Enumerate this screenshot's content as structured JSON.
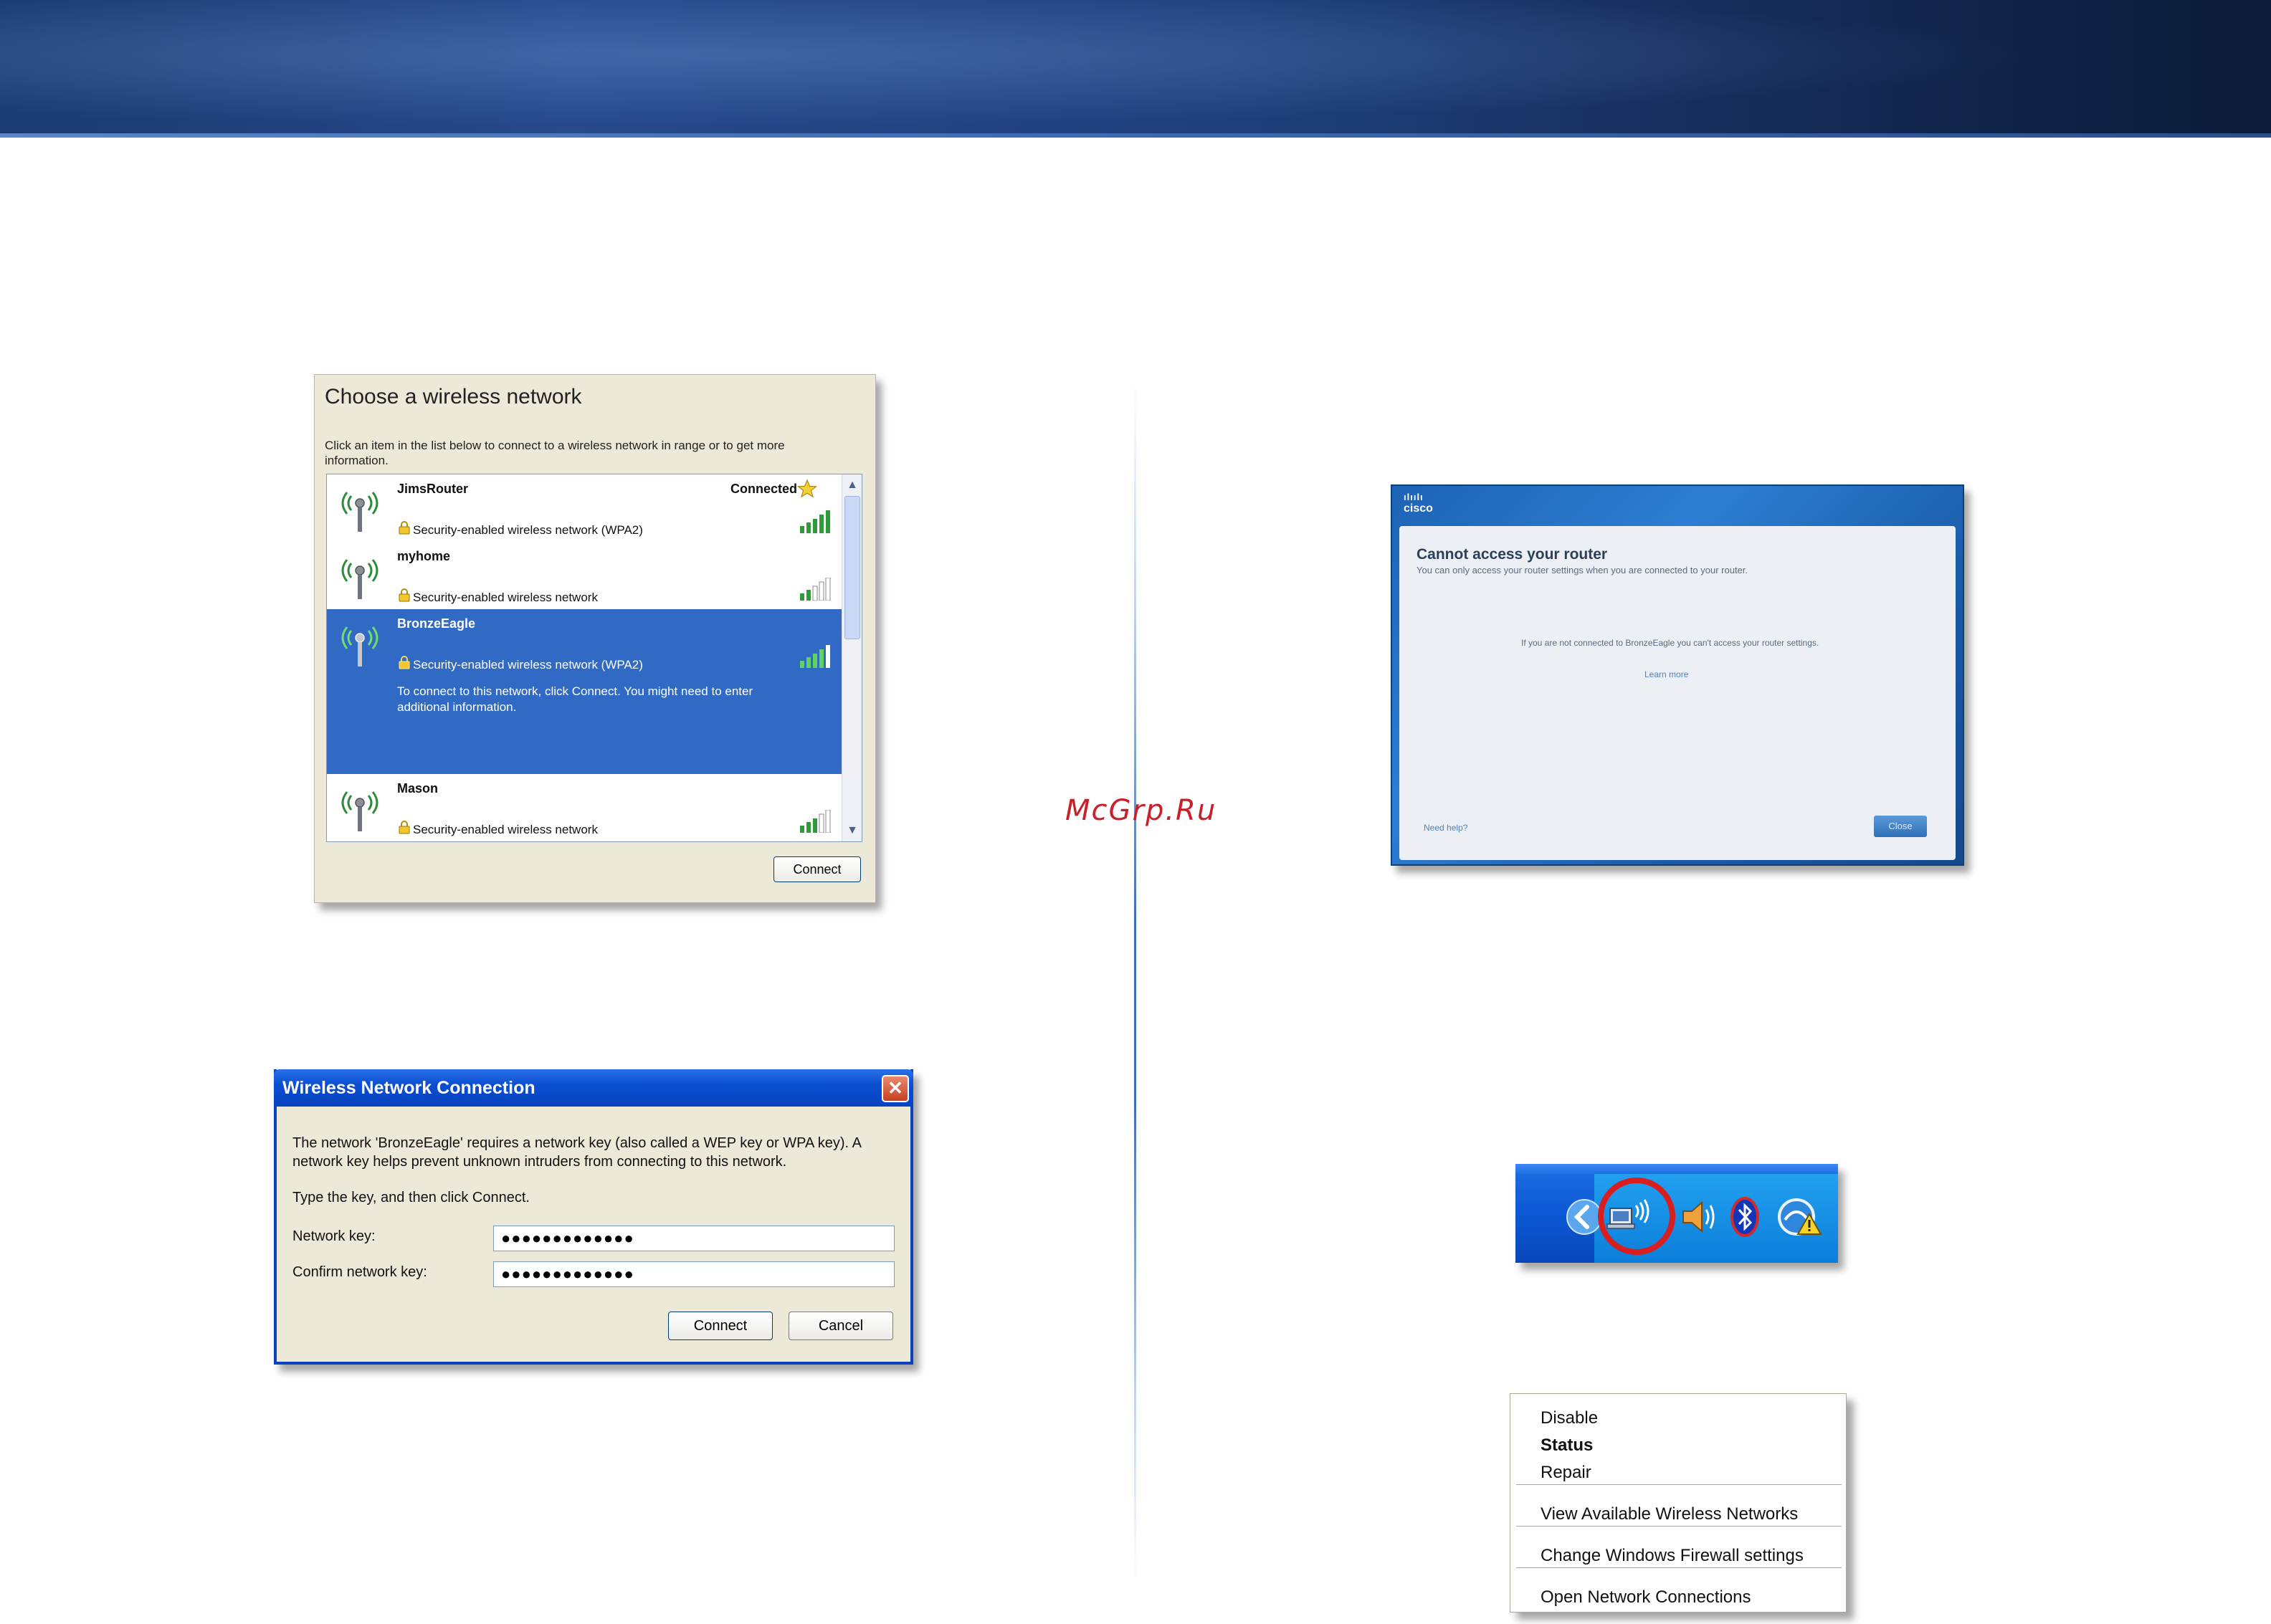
{
  "watermark": "McGrp.Ru",
  "choose_dialog": {
    "title": "Choose a wireless network",
    "description": "Click an item in the list below to connect to a wireless network in range or to get more information.",
    "networks": [
      {
        "name": "JimsRouter",
        "status": "Connected",
        "security": "Security-enabled wireless network (WPA2)"
      },
      {
        "name": "myhome",
        "status": "",
        "security": "Security-enabled wireless network"
      },
      {
        "name": "BronzeEagle",
        "status": "",
        "security": "Security-enabled wireless network (WPA2)",
        "hint": "To connect to this network, click Connect. You might need to enter additional information."
      },
      {
        "name": "Mason",
        "status": "",
        "security": "Security-enabled wireless network"
      }
    ],
    "connect_label": "Connect",
    "selected_color": "#316ac5"
  },
  "key_dialog": {
    "title": "Wireless Network Connection",
    "close_glyph": "✕",
    "message": "The network 'BronzeEagle' requires a network key (also called a WEP key or WPA key). A network key helps prevent unknown intruders from connecting to this network.",
    "instruction": "Type the key, and then click Connect.",
    "network_key_label": "Network key:",
    "network_key_value": "●●●●●●●●●●●●●",
    "confirm_key_label": "Confirm network key:",
    "confirm_key_value": "●●●●●●●●●●●●●",
    "connect_label": "Connect",
    "cancel_label": "Cancel"
  },
  "cisco_dialog": {
    "logo": "cisco",
    "logo_dots": "ılıılı",
    "heading": "Cannot access your router",
    "subheading": "You can only access your router settings when you are connected to your router.",
    "message": "If you are not connected to BronzeEagle you can't access your router settings.",
    "learn_more": "Learn more",
    "help": "Need help?",
    "close_label": "Close"
  },
  "tray": {
    "icons": [
      "chevron-left-icon",
      "wireless-network-icon",
      "speaker-icon",
      "bluetooth-icon",
      "security-alert-icon"
    ],
    "highlight_color": "#d81e1e"
  },
  "context_menu": {
    "items": [
      {
        "label": "Disable",
        "bold": false
      },
      {
        "label": "Status",
        "bold": true
      },
      {
        "label": "Repair",
        "bold": false
      },
      {
        "label": "View Available Wireless Networks",
        "bold": false
      },
      {
        "label": "Change Windows Firewall settings",
        "bold": false
      },
      {
        "label": "Open Network Connections",
        "bold": false
      }
    ]
  }
}
